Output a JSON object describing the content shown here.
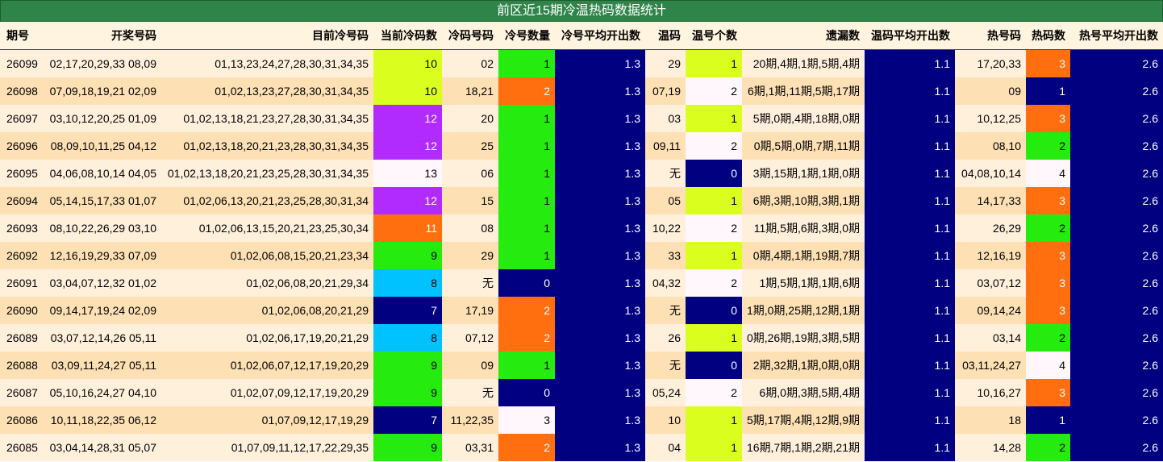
{
  "title": "前区近15期冷温热码数据统计",
  "headers": [
    "期号",
    "开奖号码",
    "目前冷号码",
    "当前冷码数",
    "冷码号码",
    "冷号数量",
    "冷号平均开出数",
    "温码",
    "温号个数",
    "遗漏数",
    "温码平均开出数",
    "热号码",
    "热码数",
    "热号平均开出数"
  ],
  "colors": {
    "lime": "#daff1f",
    "purple": "#b12bff",
    "orange": "#ff6f10",
    "green": "#26eb0e",
    "cyan": "#00c2ff",
    "navy": "#000080",
    "white": "#fff7fb"
  },
  "rows": [
    {
      "period": "26099",
      "draw": "02,17,20,29,33 08,09",
      "cold_numbers": "01,13,23,24,27,28,30,31,34,35",
      "cold_count": "10",
      "cold_count_color": "lime",
      "cold_codes": "02",
      "cold_qty": "1",
      "cold_qty_color": "green",
      "cold_avg": "1.3",
      "warm_codes": "29",
      "warm_qty": "1",
      "warm_qty_color": "lime",
      "omissions": "20期,4期,1期,5期,4期",
      "warm_avg": "1.1",
      "hot_codes": "17,20,33",
      "hot_qty": "3",
      "hot_qty_color": "orange",
      "hot_avg": "2.6"
    },
    {
      "period": "26098",
      "draw": "07,09,18,19,21 02,09",
      "cold_numbers": "01,02,13,23,27,28,30,31,34,35",
      "cold_count": "10",
      "cold_count_color": "lime",
      "cold_codes": "18,21",
      "cold_qty": "2",
      "cold_qty_color": "orange",
      "cold_avg": "1.3",
      "warm_codes": "07,19",
      "warm_qty": "2",
      "warm_qty_color": "white",
      "omissions": "6期,1期,11期,5期,17期",
      "warm_avg": "1.1",
      "hot_codes": "09",
      "hot_qty": "1",
      "hot_qty_color": "navy",
      "hot_avg": "2.6"
    },
    {
      "period": "26097",
      "draw": "03,10,12,20,25 01,09",
      "cold_numbers": "01,02,13,18,21,23,27,28,30,31,34,35",
      "cold_count": "12",
      "cold_count_color": "purple",
      "cold_codes": "20",
      "cold_qty": "1",
      "cold_qty_color": "green",
      "cold_avg": "1.3",
      "warm_codes": "03",
      "warm_qty": "1",
      "warm_qty_color": "lime",
      "omissions": "5期,0期,4期,18期,0期",
      "warm_avg": "1.1",
      "hot_codes": "10,12,25",
      "hot_qty": "3",
      "hot_qty_color": "orange",
      "hot_avg": "2.6"
    },
    {
      "period": "26096",
      "draw": "08,09,10,11,25 04,12",
      "cold_numbers": "01,02,13,18,20,21,23,28,30,31,34,35",
      "cold_count": "12",
      "cold_count_color": "purple",
      "cold_codes": "25",
      "cold_qty": "1",
      "cold_qty_color": "green",
      "cold_avg": "1.3",
      "warm_codes": "09,11",
      "warm_qty": "2",
      "warm_qty_color": "white",
      "omissions": "0期,5期,0期,7期,11期",
      "warm_avg": "1.1",
      "hot_codes": "08,10",
      "hot_qty": "2",
      "hot_qty_color": "green",
      "hot_avg": "2.6"
    },
    {
      "period": "26095",
      "draw": "04,06,08,10,14 04,05",
      "cold_numbers": "01,02,13,18,20,21,23,25,28,30,31,34,35",
      "cold_count": "13",
      "cold_count_color": "white",
      "cold_codes": "06",
      "cold_qty": "1",
      "cold_qty_color": "green",
      "cold_avg": "1.3",
      "warm_codes": "无",
      "warm_qty": "0",
      "warm_qty_color": "navy",
      "omissions": "3期,15期,1期,1期,0期",
      "warm_avg": "1.1",
      "hot_codes": "04,08,10,14",
      "hot_qty": "4",
      "hot_qty_color": "white",
      "hot_avg": "2.6"
    },
    {
      "period": "26094",
      "draw": "05,14,15,17,33 01,07",
      "cold_numbers": "01,02,06,13,20,21,23,25,28,30,31,34",
      "cold_count": "12",
      "cold_count_color": "purple",
      "cold_codes": "15",
      "cold_qty": "1",
      "cold_qty_color": "green",
      "cold_avg": "1.3",
      "warm_codes": "05",
      "warm_qty": "1",
      "warm_qty_color": "lime",
      "omissions": "6期,3期,10期,3期,1期",
      "warm_avg": "1.1",
      "hot_codes": "14,17,33",
      "hot_qty": "3",
      "hot_qty_color": "orange",
      "hot_avg": "2.6"
    },
    {
      "period": "26093",
      "draw": "08,10,22,26,29 03,10",
      "cold_numbers": "01,02,06,13,15,20,21,23,25,30,34",
      "cold_count": "11",
      "cold_count_color": "orange",
      "cold_codes": "08",
      "cold_qty": "1",
      "cold_qty_color": "green",
      "cold_avg": "1.3",
      "warm_codes": "10,22",
      "warm_qty": "2",
      "warm_qty_color": "white",
      "omissions": "11期,5期,6期,3期,0期",
      "warm_avg": "1.1",
      "hot_codes": "26,29",
      "hot_qty": "2",
      "hot_qty_color": "green",
      "hot_avg": "2.6"
    },
    {
      "period": "26092",
      "draw": "12,16,19,29,33 07,09",
      "cold_numbers": "01,02,06,08,15,20,21,23,34",
      "cold_count": "9",
      "cold_count_color": "green",
      "cold_codes": "29",
      "cold_qty": "1",
      "cold_qty_color": "green",
      "cold_avg": "1.3",
      "warm_codes": "33",
      "warm_qty": "1",
      "warm_qty_color": "lime",
      "omissions": "0期,4期,1期,19期,7期",
      "warm_avg": "1.1",
      "hot_codes": "12,16,19",
      "hot_qty": "3",
      "hot_qty_color": "orange",
      "hot_avg": "2.6"
    },
    {
      "period": "26091",
      "draw": "03,04,07,12,32 01,02",
      "cold_numbers": "01,02,06,08,20,21,29,34",
      "cold_count": "8",
      "cold_count_color": "cyan",
      "cold_codes": "无",
      "cold_qty": "0",
      "cold_qty_color": "navy",
      "cold_avg": "1.3",
      "warm_codes": "04,32",
      "warm_qty": "2",
      "warm_qty_color": "white",
      "omissions": "1期,5期,1期,1期,6期",
      "warm_avg": "1.1",
      "hot_codes": "03,07,12",
      "hot_qty": "3",
      "hot_qty_color": "orange",
      "hot_avg": "2.6"
    },
    {
      "period": "26090",
      "draw": "09,14,17,19,24 02,09",
      "cold_numbers": "01,02,06,08,20,21,29",
      "cold_count": "7",
      "cold_count_color": "navy",
      "cold_codes": "17,19",
      "cold_qty": "2",
      "cold_qty_color": "orange",
      "cold_avg": "1.3",
      "warm_codes": "无",
      "warm_qty": "0",
      "warm_qty_color": "navy",
      "omissions": "1期,0期,25期,12期,1期",
      "warm_avg": "1.1",
      "hot_codes": "09,14,24",
      "hot_qty": "3",
      "hot_qty_color": "orange",
      "hot_avg": "2.6"
    },
    {
      "period": "26089",
      "draw": "03,07,12,14,26 05,11",
      "cold_numbers": "01,02,06,17,19,20,21,29",
      "cold_count": "8",
      "cold_count_color": "cyan",
      "cold_codes": "07,12",
      "cold_qty": "2",
      "cold_qty_color": "orange",
      "cold_avg": "1.3",
      "warm_codes": "26",
      "warm_qty": "1",
      "warm_qty_color": "lime",
      "omissions": "0期,26期,19期,3期,5期",
      "warm_avg": "1.1",
      "hot_codes": "03,14",
      "hot_qty": "2",
      "hot_qty_color": "green",
      "hot_avg": "2.6"
    },
    {
      "period": "26088",
      "draw": "03,09,11,24,27 05,11",
      "cold_numbers": "01,02,06,07,12,17,19,20,29",
      "cold_count": "9",
      "cold_count_color": "green",
      "cold_codes": "09",
      "cold_qty": "1",
      "cold_qty_color": "green",
      "cold_avg": "1.3",
      "warm_codes": "无",
      "warm_qty": "0",
      "warm_qty_color": "navy",
      "omissions": "2期,32期,1期,0期,0期",
      "warm_avg": "1.1",
      "hot_codes": "03,11,24,27",
      "hot_qty": "4",
      "hot_qty_color": "white",
      "hot_avg": "2.6"
    },
    {
      "period": "26087",
      "draw": "05,10,16,24,27 04,10",
      "cold_numbers": "01,02,07,09,12,17,19,20,29",
      "cold_count": "9",
      "cold_count_color": "green",
      "cold_codes": "无",
      "cold_qty": "0",
      "cold_qty_color": "navy",
      "cold_avg": "1.3",
      "warm_codes": "05,24",
      "warm_qty": "2",
      "warm_qty_color": "white",
      "omissions": "6期,0期,3期,5期,4期",
      "warm_avg": "1.1",
      "hot_codes": "10,16,27",
      "hot_qty": "3",
      "hot_qty_color": "orange",
      "hot_avg": "2.6"
    },
    {
      "period": "26086",
      "draw": "10,11,18,22,35 06,12",
      "cold_numbers": "01,07,09,12,17,19,29",
      "cold_count": "7",
      "cold_count_color": "navy",
      "cold_codes": "11,22,35",
      "cold_qty": "3",
      "cold_qty_color": "white",
      "cold_avg": "1.3",
      "warm_codes": "10",
      "warm_qty": "1",
      "warm_qty_color": "lime",
      "omissions": "5期,17期,4期,12期,9期",
      "warm_avg": "1.1",
      "hot_codes": "18",
      "hot_qty": "1",
      "hot_qty_color": "navy",
      "hot_avg": "2.6"
    },
    {
      "period": "26085",
      "draw": "03,04,14,28,31 05,07",
      "cold_numbers": "01,07,09,11,12,17,22,29,35",
      "cold_count": "9",
      "cold_count_color": "green",
      "cold_codes": "03,31",
      "cold_qty": "2",
      "cold_qty_color": "orange",
      "cold_avg": "1.3",
      "warm_codes": "04",
      "warm_qty": "1",
      "warm_qty_color": "lime",
      "omissions": "16期,7期,1期,2期,21期",
      "warm_avg": "1.1",
      "hot_codes": "14,28",
      "hot_qty": "2",
      "hot_qty_color": "green",
      "hot_avg": "2.6"
    }
  ]
}
